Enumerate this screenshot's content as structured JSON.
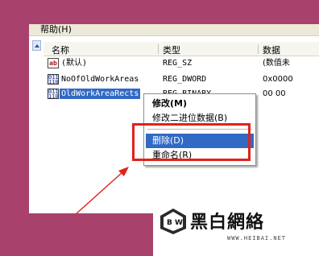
{
  "menubar": {
    "help": "帮助(H)"
  },
  "columns": {
    "name": "名称",
    "type": "类型",
    "data": "数据"
  },
  "rows": [
    {
      "name": "(默认)",
      "type": "REG_SZ",
      "data": "(数值未",
      "icon": "string-value-icon"
    },
    {
      "name": "NoOfOldWorkAreas",
      "type": "REG_DWORD",
      "data": "0x0000",
      "icon": "binary-value-icon"
    },
    {
      "name": "OldWorkAreaRects",
      "type": "REG_BINARY",
      "data": "00 00",
      "icon": "binary-value-icon"
    }
  ],
  "icon_labels": {
    "string": "ab",
    "binary": "011\n110"
  },
  "context_menu": {
    "modify": "修改(M)",
    "modify_binary": "修改二进位数据(B)",
    "delete": "删除(D)",
    "rename": "重命名(R)"
  },
  "watermark": {
    "site_cn": "黑白網絡",
    "url": "WWW.HEIBAI.NET",
    "logo": "B W"
  },
  "colors": {
    "background": "#a8416c",
    "highlight": "#316ac5",
    "annotation_red": "#e0221a"
  }
}
